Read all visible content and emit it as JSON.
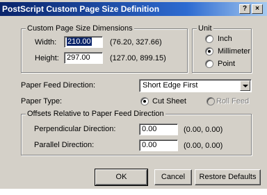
{
  "window": {
    "title": "PostScript Custom Page Size Definition",
    "help_label": "?",
    "close_label": "×"
  },
  "dimensions": {
    "legend": "Custom Page Size Dimensions",
    "width_label": "Width:",
    "width_value": "210.00",
    "width_range": "(76.20, 327.66)",
    "height_label": "Height:",
    "height_value": "297.00",
    "height_range": "(127.00, 899.15)"
  },
  "unit": {
    "legend": "Unit",
    "options": [
      "Inch",
      "Millimeter",
      "Point"
    ],
    "selected": "Millimeter"
  },
  "paper_feed": {
    "label": "Paper Feed Direction:",
    "value": "Short Edge First"
  },
  "paper_type": {
    "label": "Paper Type:",
    "options": [
      "Cut Sheet",
      "Roll Feed"
    ],
    "selected": "Cut Sheet"
  },
  "offsets": {
    "legend": "Offsets Relative to Paper Feed Direction",
    "perpendicular_label": "Perpendicular Direction:",
    "perpendicular_value": "0.00",
    "perpendicular_range": "(0.00, 0.00)",
    "parallel_label": "Parallel Direction:",
    "parallel_value": "0.00",
    "parallel_range": "(0.00, 0.00)"
  },
  "buttons": {
    "ok": "OK",
    "cancel": "Cancel",
    "restore": "Restore Defaults"
  }
}
